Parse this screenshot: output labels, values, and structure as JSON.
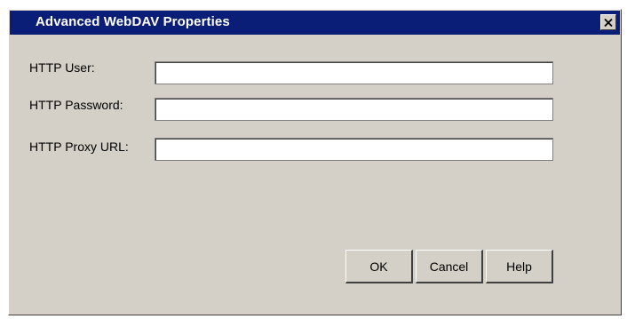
{
  "window": {
    "title": "Advanced WebDAV Properties",
    "close_icon": "close-icon",
    "titlebar_color": "#0a1e78",
    "background_color": "#d4d0c8"
  },
  "fields": {
    "user": {
      "label": "HTTP User:",
      "value": ""
    },
    "password": {
      "label": "HTTP Password:",
      "value": ""
    },
    "proxy_url": {
      "label": "HTTP Proxy URL:",
      "value": ""
    }
  },
  "buttons": {
    "ok_label": "OK",
    "cancel_label": "Cancel",
    "help_label": "Help"
  }
}
